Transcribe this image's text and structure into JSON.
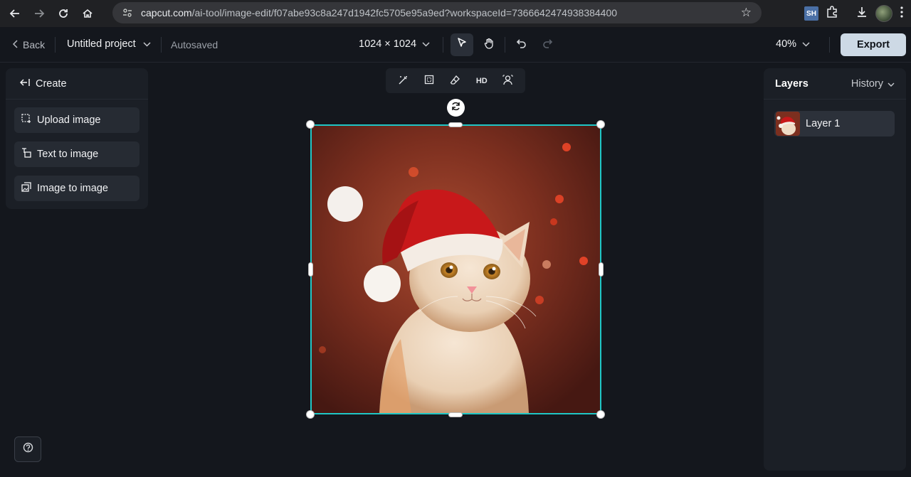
{
  "browser": {
    "url_host": "capcut.com",
    "url_path": "/ai-tool/image-edit/f07abe93c8a247d1942fc5705e95a9ed?workspaceId=7366642474938384400",
    "extension_label": "SH"
  },
  "header": {
    "back_label": "Back",
    "project_title": "Untitled project",
    "autosave_status": "Autosaved",
    "canvas_size": "1024 × 1024",
    "zoom_level": "40%",
    "export_label": "Export"
  },
  "left_panel": {
    "create_label": "Create",
    "items": [
      {
        "label": "Upload image",
        "icon": "upload-image-icon"
      },
      {
        "label": "Text to image",
        "icon": "text-to-image-icon"
      },
      {
        "label": "Image to image",
        "icon": "image-to-image-icon"
      }
    ]
  },
  "image_toolbar": {
    "hd_label": "HD"
  },
  "right_panel": {
    "tab_layers": "Layers",
    "tab_history": "History",
    "layers": [
      {
        "label": "Layer 1"
      }
    ]
  },
  "colors": {
    "accent_selection": "#1fc6c6",
    "export_bg": "#cdd9e5",
    "panel_bg": "#1b1f26",
    "page_bg": "#14171d"
  }
}
